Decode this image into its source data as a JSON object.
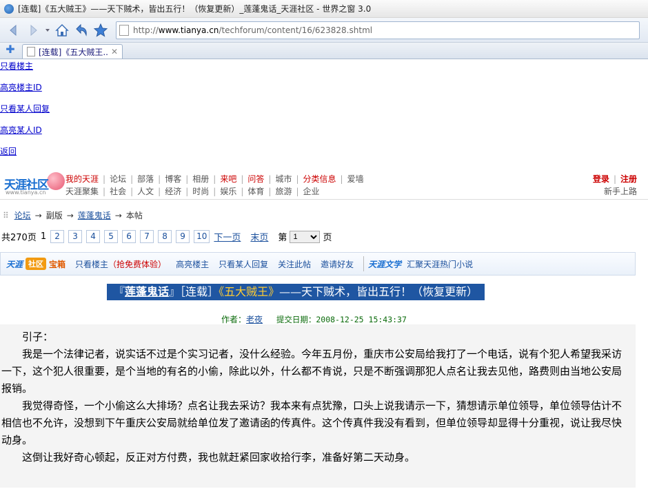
{
  "window": {
    "title": "[连载]《五大贼王》——天下贼术，皆出五行！（恢复更新）_莲蓬鬼话_天涯社区 - 世界之窗 3.0"
  },
  "browser": {
    "url_prefix": "http://",
    "url_host": "www.tianya.cn",
    "url_path": "/techforum/content/16/623828.shtml",
    "tab_title": "[连载]《五大贼王...",
    "new_tab_label": "✚",
    "tab_close": "✕"
  },
  "top_links": [
    "只看楼主",
    "高亮楼主ID",
    "只看某人回复",
    "高亮某人ID",
    "返回"
  ],
  "site": {
    "logo_text": "天涯社区",
    "logo_sub": "www.tianya.cn",
    "nav_row1": [
      {
        "label": "我的天涯",
        "red": true
      },
      {
        "label": "论坛",
        "red": false
      },
      {
        "label": "部落",
        "red": false
      },
      {
        "label": "博客",
        "red": false
      },
      {
        "label": "相册",
        "red": false
      },
      {
        "label": "来吧",
        "red": true
      },
      {
        "label": "问答",
        "red": true
      },
      {
        "label": "城市",
        "red": false
      },
      {
        "label": "分类信息",
        "red": true
      },
      {
        "label": "爱墙",
        "red": false
      }
    ],
    "nav_row2": [
      "天涯聚集",
      "社会",
      "人文",
      "经济",
      "时尚",
      "娱乐",
      "体育",
      "旅游",
      "企业"
    ],
    "login": "登录",
    "register": "注册",
    "newbie": "新手上路"
  },
  "breadcrumb": {
    "items": [
      "论坛",
      "副版",
      "莲蓬鬼话",
      "本帖"
    ]
  },
  "pager": {
    "total": "共270页",
    "current": "1",
    "pages": [
      "2",
      "3",
      "4",
      "5",
      "6",
      "7",
      "8",
      "9",
      "10"
    ],
    "next": "下一页",
    "last": "末页",
    "goto_prefix": "第",
    "goto_value": "1",
    "goto_suffix": "页"
  },
  "toolbox": {
    "brand": "天涯",
    "badge": "社区",
    "badge2": "宝箱",
    "owner_only": "只看楼主",
    "owner_only_note": "（抢免费体验）",
    "highlight_owner": "高亮楼主",
    "someone_reply": "只看某人回复",
    "follow": "关注此帖",
    "invite": "邀请好友",
    "lit_brand": "天涯文学",
    "lit_link": "汇聚天涯热门小说"
  },
  "post": {
    "title_board": "莲蓬鬼话",
    "title_tag": "［连载］",
    "title_book": "《五大贼王》",
    "title_rest": "——天下贼术，皆出五行！（恢复更新）",
    "author_label": "作者：",
    "author": "老夜",
    "date_label": "提交日期：",
    "date": "2008-12-25 15:43:37",
    "paragraphs": [
      "引子：",
      "我是一个法律记者，说实话不过是个实习记者，没什么经验。今年五月份，重庆市公安局给我打了一个电话，说有个犯人希望我采访一下，这个犯人很重要，是个当地的有名的小偷，除此以外，什么都不肯说，只是不断强调那犯人点名让我去见他，路费则由当地公安局报销。",
      "我觉得奇怪，一个小偷这么大排场？点名让我去采访？我本来有点犹豫，口头上说我请示一下，猜想请示单位领导，单位领导估计不相信也不允许，没想到下午重庆公安局就给单位发了邀请函的传真件。这个传真件我没有看到，但单位领导却显得十分重视，说让我尽快动身。",
      "这倒让我好奇心顿起，反正对方付费，我也就赶紧回家收拾行李，准备好第二天动身。"
    ]
  }
}
